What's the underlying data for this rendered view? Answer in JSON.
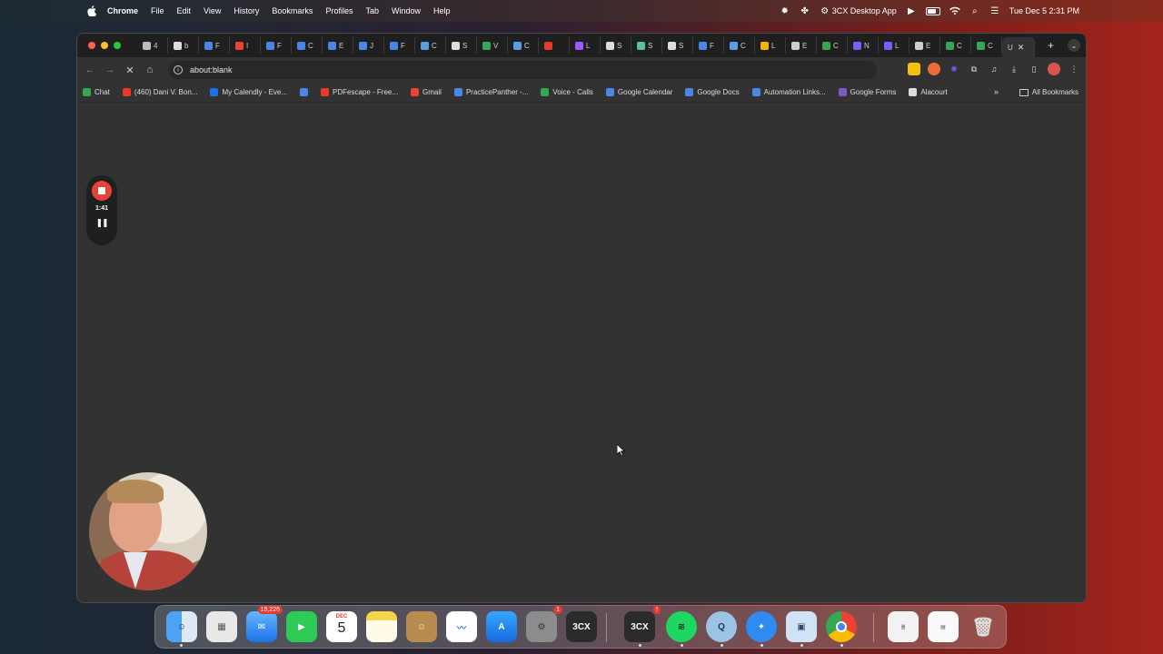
{
  "menubar": {
    "app": "Chrome",
    "items": [
      "File",
      "Edit",
      "View",
      "History",
      "Bookmarks",
      "Profiles",
      "Tab",
      "Window",
      "Help"
    ],
    "status_app": "3CX Desktop App",
    "clock": "Tue Dec 5  2:31 PM"
  },
  "tabs": [
    {
      "label": "4",
      "color": "#bbbbbb"
    },
    {
      "label": "b",
      "color": "#dddddd"
    },
    {
      "label": "F",
      "color": "#4a86e8"
    },
    {
      "label": "I",
      "color": "#ea4335"
    },
    {
      "label": "F",
      "color": "#4a86e8"
    },
    {
      "label": "C",
      "color": "#4a86e8"
    },
    {
      "label": "E",
      "color": "#4a86e8"
    },
    {
      "label": "J",
      "color": "#4a86e8"
    },
    {
      "label": "F",
      "color": "#4a86e8"
    },
    {
      "label": "C",
      "color": "#5aa0e0"
    },
    {
      "label": "S",
      "color": "#dddddd"
    },
    {
      "label": "V",
      "color": "#34a853"
    },
    {
      "label": "C",
      "color": "#5aa0e0"
    },
    {
      "label": "",
      "color": "#e8392f"
    },
    {
      "label": "L",
      "color": "#9b59ff"
    },
    {
      "label": "S",
      "color": "#dddddd"
    },
    {
      "label": "S",
      "color": "#58c2a0"
    },
    {
      "label": "S",
      "color": "#dddddd"
    },
    {
      "label": "F",
      "color": "#4a86e8"
    },
    {
      "label": "C",
      "color": "#5aa0e0"
    },
    {
      "label": "L",
      "color": "#f4b400"
    },
    {
      "label": "E",
      "color": "#cccccc"
    },
    {
      "label": "C",
      "color": "#34a853"
    },
    {
      "label": "N",
      "color": "#7b5cff"
    },
    {
      "label": "L",
      "color": "#7b5cff"
    },
    {
      "label": "E",
      "color": "#cccccc"
    },
    {
      "label": "C",
      "color": "#34a853"
    },
    {
      "label": "C",
      "color": "#34a853"
    }
  ],
  "active_tab": {
    "label": "U",
    "close": "✕"
  },
  "new_tab": "+",
  "omnibox": {
    "url": "about:blank"
  },
  "bookmarks": [
    {
      "label": "Chat",
      "color": "#34a853"
    },
    {
      "label": "(460) Dani V. Bon...",
      "color": "#e8392f"
    },
    {
      "label": "My Calendly - Eve...",
      "color": "#1a73e8"
    },
    {
      "label": "",
      "color": "#4a86e8"
    },
    {
      "label": "PDFescape - Free...",
      "color": "#e8392f"
    },
    {
      "label": "Gmail",
      "color": "#ea4335"
    },
    {
      "label": "PracticePanther -...",
      "color": "#4a86e8"
    },
    {
      "label": "Voice - Calls",
      "color": "#34a853"
    },
    {
      "label": "Google Calendar",
      "color": "#4a86e8"
    },
    {
      "label": "Google Docs",
      "color": "#4a86e8"
    },
    {
      "label": "Automation Links...",
      "color": "#4a86e8"
    },
    {
      "label": "Google Forms",
      "color": "#7e57c2"
    },
    {
      "label": "Alacourt",
      "color": "#dddddd"
    }
  ],
  "bookmarks_more": "»",
  "all_bookmarks": "All Bookmarks",
  "recorder": {
    "time": "1:41"
  },
  "dock": {
    "mail_badge": "19,226",
    "calendar_month": "DEC",
    "calendar_day": "5",
    "settings_badge": "1",
    "app_3cx": "3CX",
    "app_3cx_badge": "!"
  }
}
